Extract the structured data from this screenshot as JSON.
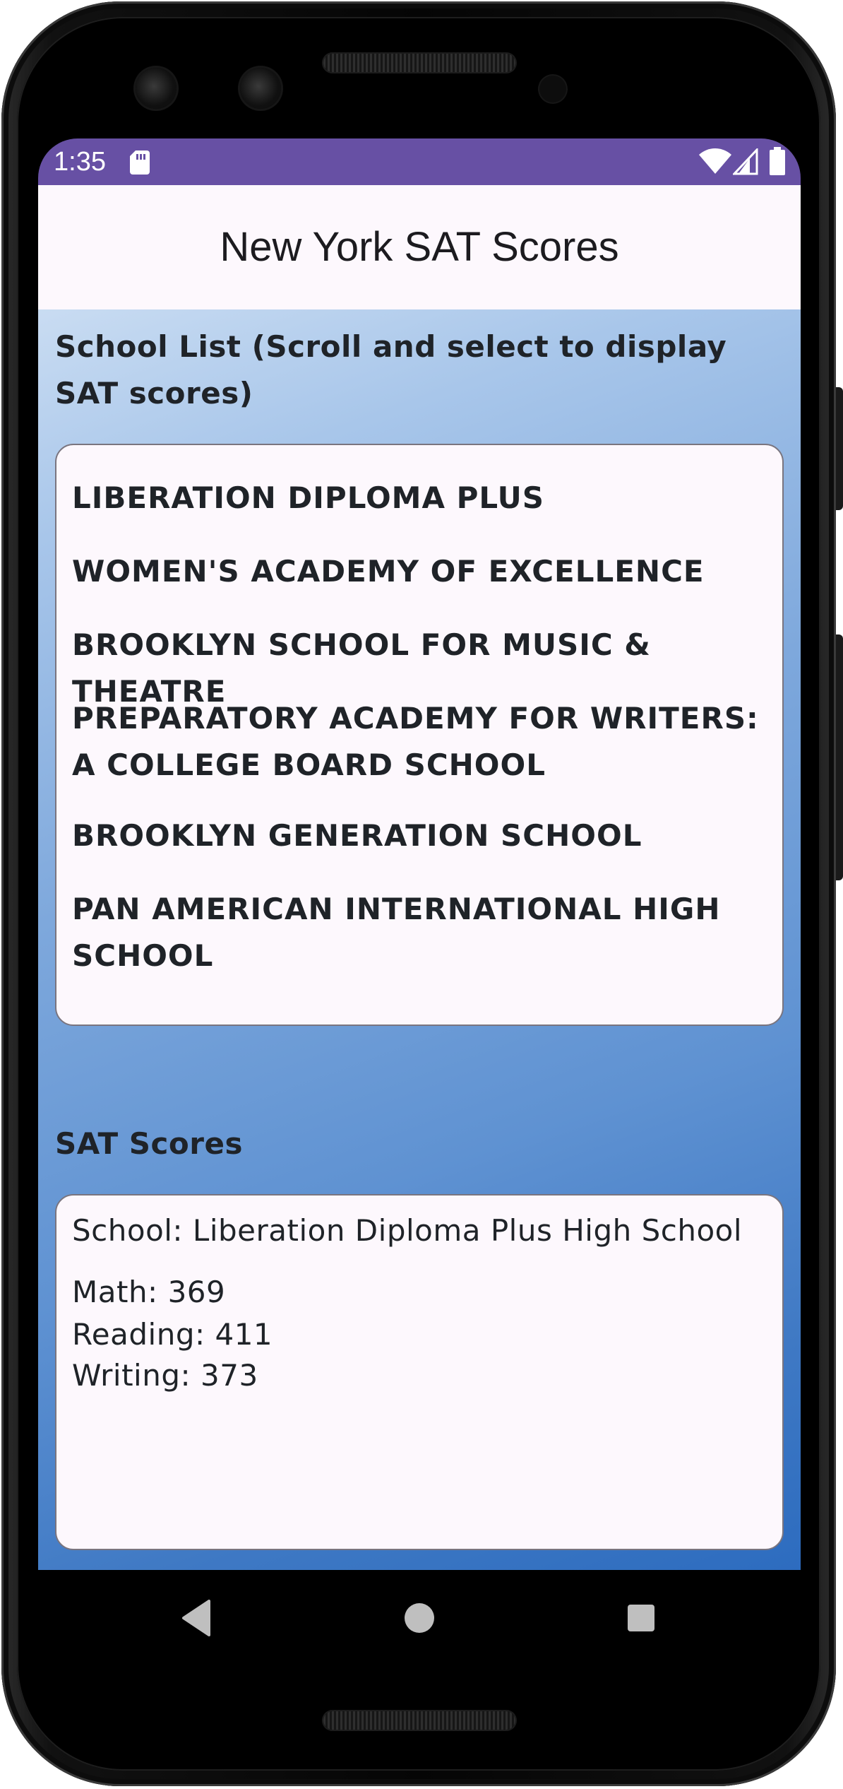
{
  "status_bar": {
    "time": "1:35",
    "icons": [
      "sd-card-icon",
      "wifi-icon",
      "signal-icon",
      "battery-icon"
    ],
    "background_color": "#6750a4"
  },
  "app_bar": {
    "title": "New York SAT Scores"
  },
  "school_list": {
    "heading": "School List (Scroll and select to display SAT scores)",
    "items": [
      "LIBERATION DIPLOMA PLUS",
      "WOMEN'S ACADEMY OF EXCELLENCE",
      "BROOKLYN SCHOOL FOR MUSIC & THEATRE",
      "PREPARATORY ACADEMY FOR WRITERS: A COLLEGE BOARD SCHOOL",
      "BROOKLYN GENERATION SCHOOL",
      "PAN AMERICAN INTERNATIONAL HIGH SCHOOL"
    ]
  },
  "sat_scores": {
    "heading": "SAT Scores",
    "school": "School: Liberation Diploma Plus High School",
    "math": "Math: 369",
    "reading": "Reading: 411",
    "writing": "Writing: 373"
  },
  "navigation": {
    "icons": [
      "back-icon",
      "home-icon",
      "recents-icon"
    ]
  },
  "colors": {
    "accent": "#6750a4",
    "surface": "#fdf8fd",
    "gradient_light": "#c9dcf2",
    "gradient_dark": "#2d6cbf"
  }
}
